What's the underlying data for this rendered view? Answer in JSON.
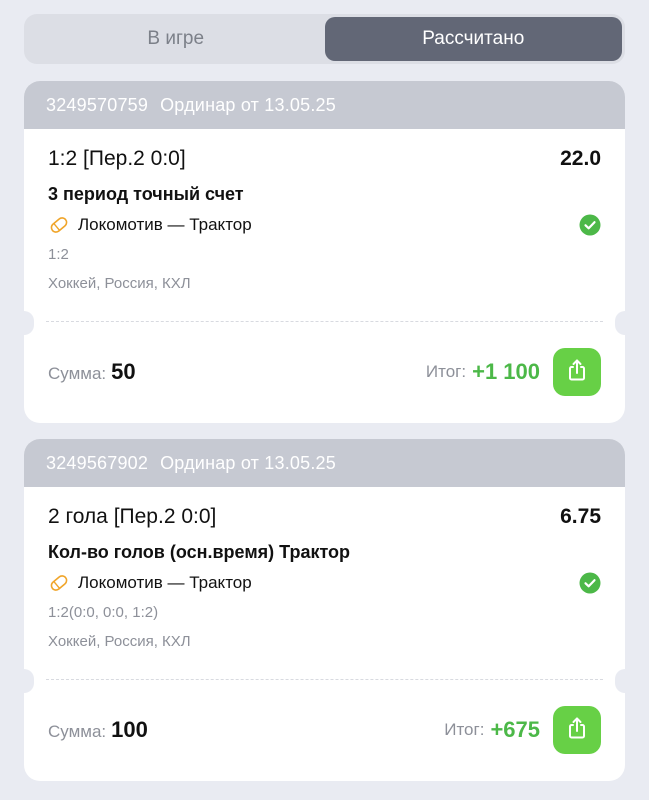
{
  "tabs": [
    {
      "label": "В игре",
      "active": false
    },
    {
      "label": "Рассчитано",
      "active": true
    }
  ],
  "colors": {
    "background": "#e9ebf2",
    "active_tab": "#626776",
    "card_header": "#c6c9d2",
    "win_green": "#4cb848",
    "share_button": "#67d046",
    "sport_icon": "#f0a52a"
  },
  "bets": [
    {
      "id": "3249570759",
      "type_date": "Ординар от 13.05.25",
      "pick": "1:2 [Пер.2 0:0]",
      "odds": "22.0",
      "market": "3 период точный счет",
      "event": "Локомотив — Трактор",
      "event_icon": "hockey-puck-icon",
      "status_icon": "check-circle-icon",
      "score": "1:2",
      "league": "Хоккей, Россия, КХЛ",
      "sum_label": "Сумма:",
      "sum_value": "50",
      "result_label": "Итог:",
      "result_value": "+1 100",
      "share_icon": "share-icon"
    },
    {
      "id": "3249567902",
      "type_date": "Ординар от 13.05.25",
      "pick": "2 гола [Пер.2 0:0]",
      "odds": "6.75",
      "market": "Кол-во голов (осн.время) Трактор",
      "event": "Локомотив — Трактор",
      "event_icon": "hockey-puck-icon",
      "status_icon": "check-circle-icon",
      "score": "1:2(0:0, 0:0, 1:2)",
      "league": "Хоккей, Россия, КХЛ",
      "sum_label": "Сумма:",
      "sum_value": "100",
      "result_label": "Итог:",
      "result_value": "+675",
      "share_icon": "share-icon"
    }
  ]
}
